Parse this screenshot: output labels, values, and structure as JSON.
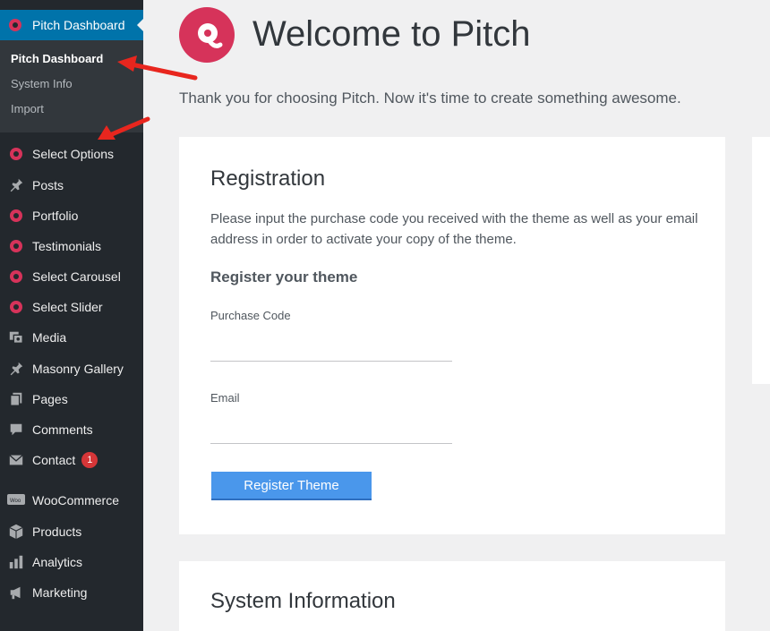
{
  "sidebar": {
    "active": {
      "label": "Pitch Dashboard",
      "icon": "pitch-icon"
    },
    "submenu": [
      {
        "label": "Pitch Dashboard",
        "current": true
      },
      {
        "label": "System Info",
        "current": false
      },
      {
        "label": "Import",
        "current": false
      }
    ],
    "items": [
      {
        "label": "Select Options",
        "icon": "select-icon"
      },
      {
        "label": "Posts",
        "icon": "pushpin-icon"
      },
      {
        "label": "Portfolio",
        "icon": "select-icon"
      },
      {
        "label": "Testimonials",
        "icon": "select-icon"
      },
      {
        "label": "Select Carousel",
        "icon": "select-icon"
      },
      {
        "label": "Select Slider",
        "icon": "select-icon"
      },
      {
        "label": "Media",
        "icon": "media-icon"
      },
      {
        "label": "Masonry Gallery",
        "icon": "pushpin-icon"
      },
      {
        "label": "Pages",
        "icon": "pages-icon"
      },
      {
        "label": "Comments",
        "icon": "comment-icon"
      },
      {
        "label": "Contact",
        "icon": "mail-icon",
        "badge": "1"
      },
      {
        "label": "WooCommerce",
        "icon": "woo-icon"
      },
      {
        "label": "Products",
        "icon": "box-icon"
      },
      {
        "label": "Analytics",
        "icon": "bar-chart-icon"
      },
      {
        "label": "Marketing",
        "icon": "megaphone-icon"
      }
    ]
  },
  "header": {
    "title": "Welcome to Pitch",
    "intro": "Thank you for choosing Pitch. Now it's time to create something awesome."
  },
  "registration": {
    "title": "Registration",
    "description": "Please input the purchase code you received with the theme as well as your email address in order to activate your copy of the theme.",
    "subtitle": "Register your theme",
    "purchase_code_label": "Purchase Code",
    "purchase_code_value": "",
    "email_label": "Email",
    "email_value": "",
    "button_label": "Register Theme"
  },
  "system_info": {
    "title": "System Information"
  },
  "colors": {
    "accent": "#0073aa",
    "brand": "#d6335a",
    "button": "#4a97eb",
    "sidebar": "#23282d"
  }
}
